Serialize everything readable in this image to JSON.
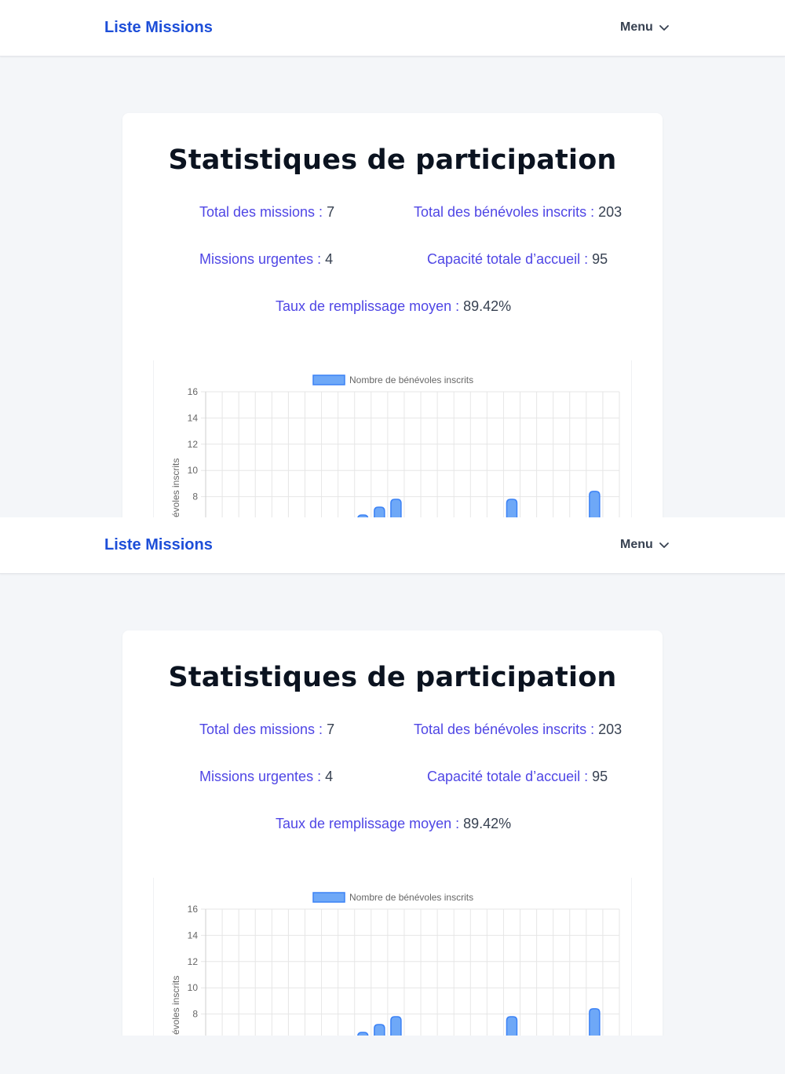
{
  "navbar": {
    "brand": "Liste Missions",
    "menu_label": "Menu"
  },
  "stats": {
    "title": "Statistiques de participation",
    "total_missions_label": "Total des missions :",
    "total_missions_value": "7",
    "total_volunteers_label": "Total des bénévoles inscrits :",
    "total_volunteers_value": "203",
    "urgent_missions_label": "Missions urgentes :",
    "urgent_missions_value": "4",
    "capacity_label": "Capacité totale d’accueil :",
    "capacity_value": "95",
    "fill_rate_label": "Taux de remplissage moyen :",
    "fill_rate_value": "89.42%"
  },
  "colors": {
    "brand": "#1d4ed8",
    "stat_label": "#4f46e5",
    "bar_fill": "#6ea8f7",
    "bar_stroke": "#3b82f6"
  },
  "chart_data": {
    "type": "bar",
    "legend": [
      "Nombre de bénévoles inscrits"
    ],
    "legend_position": "top",
    "ylabel": "Nombre de bénévoles inscrits",
    "ylabel_visible": "évoles inscrits",
    "ylim": [
      0,
      16
    ],
    "yticks": [
      16,
      14,
      12,
      10,
      8
    ],
    "grid": true,
    "slots": 25,
    "bars": [
      {
        "slot": 9,
        "value": 6.6
      },
      {
        "slot": 10,
        "value": 7.2
      },
      {
        "slot": 11,
        "value": 7.8
      },
      {
        "slot": 18,
        "value": 7.8
      },
      {
        "slot": 23,
        "value": 8.4
      }
    ]
  }
}
